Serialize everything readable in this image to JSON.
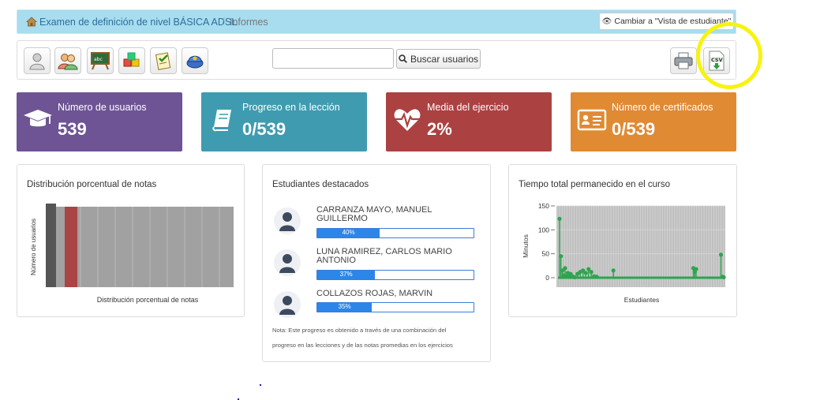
{
  "breadcrumb": {
    "course": "Examen de definición de nivel BÁSICA ADSL",
    "separator": "/",
    "current": "Informes"
  },
  "student_view_button": {
    "icon": "eye-icon",
    "label": "Cambiar a \"Vista de estudiante\""
  },
  "toolbar": {
    "tools": [
      {
        "icon": "user-icon"
      },
      {
        "icon": "users-group-icon"
      },
      {
        "icon": "blackboard-icon"
      },
      {
        "icon": "cubes-icon"
      },
      {
        "icon": "checklist-icon"
      },
      {
        "icon": "tutor-cap-icon"
      }
    ],
    "search_placeholder": "",
    "search_value": "",
    "search_button": "Buscar usuarios",
    "print_icon": "printer-icon",
    "csv_icon": "csv-export-icon"
  },
  "cards": [
    {
      "label": "Número de usuarios",
      "value": "539",
      "color": "#6e5494",
      "icon": "graduation-cap-icon"
    },
    {
      "label": "Progreso en la lección",
      "value": "0/539",
      "color": "#3f9bb0",
      "icon": "book-icon"
    },
    {
      "label": "Media del ejercicio",
      "value": "2%",
      "color": "#ac4141",
      "icon": "heartbeat-icon"
    },
    {
      "label": "Número de certificados",
      "value": "0/539",
      "color": "#e08a34",
      "icon": "id-card-icon"
    }
  ],
  "distribution_panel": {
    "title": "Distribución porcentual de notas",
    "chart_ylabel": "Número de usuarios",
    "chart_xlabel": "Distribución porcentual de notas"
  },
  "top_students_panel": {
    "title": "Estudiantes destacados",
    "students": [
      {
        "name": "CARRANZA MAYO, MANUEL GUILLERMO",
        "progress": 40,
        "progress_label": "40%"
      },
      {
        "name": "LUNA RAMIREZ, CARLOS MARIO ANTONIO",
        "progress": 37,
        "progress_label": "37%"
      },
      {
        "name": "COLLAZOS ROJAS, MARVIN",
        "progress": 35,
        "progress_label": "35%"
      }
    ],
    "note_line1": "Nota: Este progreso es obtenido a través de una combinación del",
    "note_line2": "progreso en las lecciones y de las notas promedias en los ejercicios"
  },
  "time_panel": {
    "title": "Tiempo total permanecido en el curso"
  },
  "chart_data": {
    "type": "scatter",
    "title": "Tiempo total permanecido en el curso",
    "xlabel": "Estudiantes",
    "ylabel": "Minutos",
    "ylim": [
      0,
      150
    ],
    "yticks": [
      "150",
      "100",
      "50",
      "0"
    ],
    "ytick_values": [
      150,
      100,
      50,
      0
    ],
    "grid": true,
    "series_color": "#2ea44f",
    "x": [
      1,
      2,
      3,
      4,
      5,
      6,
      7,
      8,
      9,
      10,
      11,
      12,
      14,
      16,
      18,
      20,
      22,
      24,
      26,
      28,
      40,
      98,
      99,
      100,
      118,
      119,
      120
    ],
    "values": [
      123,
      45,
      15,
      5,
      20,
      3,
      10,
      2,
      8,
      3,
      2,
      1,
      8,
      12,
      15,
      10,
      18,
      12,
      3,
      2,
      15,
      20,
      12,
      18,
      48,
      2,
      1
    ]
  }
}
